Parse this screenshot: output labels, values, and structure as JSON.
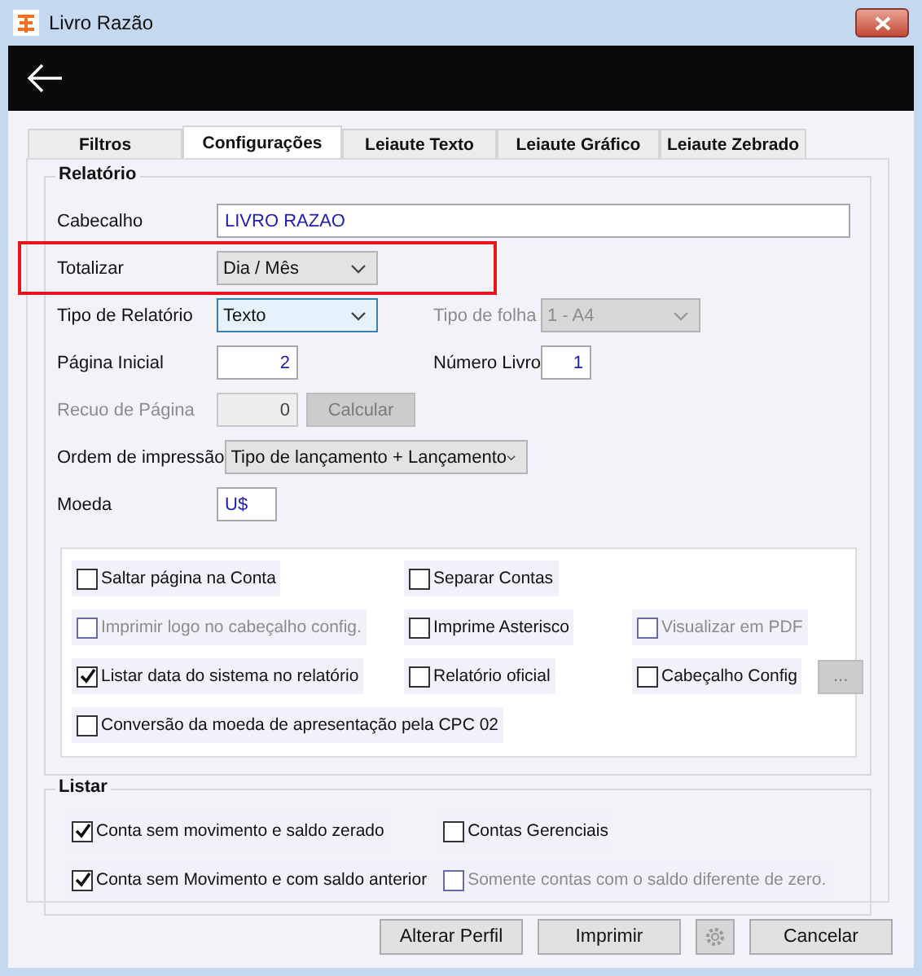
{
  "window": {
    "title": "Livro Razão"
  },
  "tabs": [
    {
      "label": "Filtros",
      "selected": false
    },
    {
      "label": "Configurações",
      "selected": true
    },
    {
      "label": "Leiaute Texto",
      "selected": false
    },
    {
      "label": "Leiaute Gráfico",
      "selected": false
    },
    {
      "label": "Leiaute Zebrado",
      "selected": false
    }
  ],
  "relatorio": {
    "title": "Relatório",
    "cabecalho": {
      "label": "Cabecalho",
      "value": "LIVRO RAZAO"
    },
    "totalizar": {
      "label": "Totalizar",
      "value": "Dia / Mês",
      "highlighted": true
    },
    "tipo_relatorio": {
      "label": "Tipo de Relatório",
      "value": "Texto",
      "focused": true
    },
    "tipo_folha": {
      "label": "Tipo de folha",
      "value": "1 - A4",
      "disabled": true
    },
    "pagina_inicial": {
      "label": "Página Inicial",
      "value": "2"
    },
    "numero_livro": {
      "label": "Número Livro",
      "value": "1"
    },
    "recuo": {
      "label": "Recuo de Página",
      "value": "0",
      "disabled": true,
      "button": "Calcular"
    },
    "ordem": {
      "label": "Ordem de impressão",
      "value": "Tipo de lançamento + Lançamento"
    },
    "moeda": {
      "label": "Moeda",
      "value": "U$"
    },
    "option_rows": [
      {
        "items": [
          {
            "label": "Saltar página na Conta",
            "checked": false,
            "disabled": false
          },
          {
            "label": "Separar Contas",
            "checked": false,
            "disabled": false
          }
        ]
      },
      {
        "items": [
          {
            "label": "Imprimir logo no cabeçalho config.",
            "checked": false,
            "disabled": true
          },
          {
            "label": "Imprime Asterisco",
            "checked": false,
            "disabled": false
          },
          {
            "label": "Visualizar em PDF",
            "checked": false,
            "disabled": true
          }
        ]
      },
      {
        "items": [
          {
            "label": "Listar data do sistema no relatório",
            "checked": true,
            "disabled": false
          },
          {
            "label": "Relatório oficial",
            "checked": false,
            "disabled": false
          },
          {
            "label": "Cabeçalho Config",
            "checked": false,
            "disabled": false,
            "button": "..."
          }
        ]
      },
      {
        "items": [
          {
            "label": "Conversão da moeda de apresentação pela CPC 02",
            "checked": false,
            "disabled": false
          }
        ]
      }
    ]
  },
  "listar": {
    "title": "Listar",
    "items": [
      {
        "label": "Conta sem movimento e saldo zerado",
        "checked": true,
        "disabled": false
      },
      {
        "label": "Contas Gerenciais",
        "checked": false,
        "disabled": false
      },
      {
        "label": "Conta sem Movimento e com saldo anterior",
        "checked": true,
        "disabled": false
      },
      {
        "label": "Somente contas com o saldo diferente de zero.",
        "checked": false,
        "disabled": true
      }
    ]
  },
  "buttons": [
    {
      "kind": "text",
      "label": "Alterar Perfil"
    },
    {
      "kind": "text",
      "label": "Imprimir"
    },
    {
      "kind": "gear",
      "disabled": true
    },
    {
      "kind": "text",
      "label": "Cancelar"
    }
  ]
}
